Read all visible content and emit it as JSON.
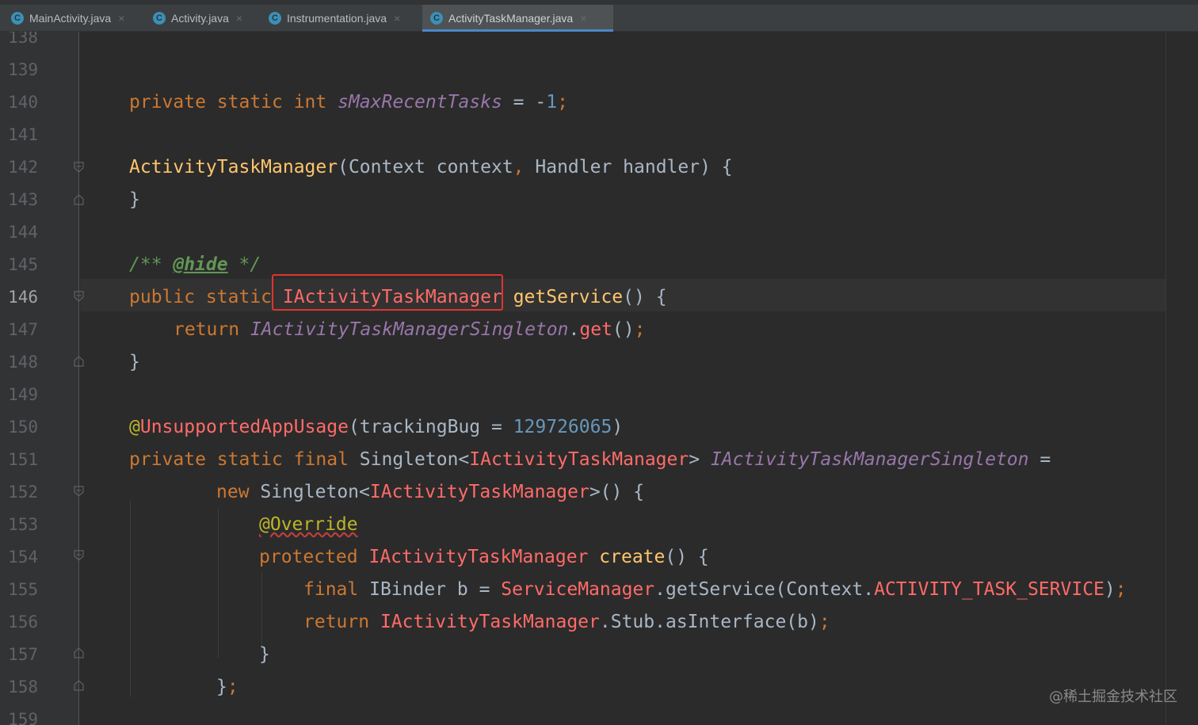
{
  "tabs": [
    {
      "label": "MainActivity.java",
      "icon": "class-icon"
    },
    {
      "label": "Activity.java",
      "icon": "class-icon"
    },
    {
      "label": "Instrumentation.java",
      "icon": "class-icon"
    },
    {
      "label": "ActivityTaskManager.java",
      "icon": "class-icon",
      "active": true
    }
  ],
  "tab_icon_letter": "C",
  "tab_close_glyph": "×",
  "line_numbers": [
    "138",
    "139",
    "140",
    "141",
    "142",
    "143",
    "144",
    "145",
    "146",
    "147",
    "148",
    "149",
    "150",
    "151",
    "152",
    "153",
    "154",
    "155",
    "156",
    "157",
    "158",
    "159"
  ],
  "current_line": "146",
  "code": {
    "l140": {
      "a": "private static int ",
      "b": "sMaxRecentTasks",
      "c": " = -",
      "d": "1",
      "e": ";"
    },
    "l142": {
      "a": "ActivityTaskManager",
      "b": "(Context context",
      "c": ",",
      "d": " Handler handler) {"
    },
    "l143": {
      "a": "}"
    },
    "l145": {
      "a": "/** ",
      "b": "@hide",
      "c": " */"
    },
    "l146": {
      "a": "public static ",
      "b": "IActivityTaskManager",
      "c": " ",
      "d": "getService",
      "e": "() {"
    },
    "l147": {
      "a": "return ",
      "b": "IActivityTaskManagerSingleton",
      "c": ".",
      "d": "get",
      "e": "()",
      "f": ";"
    },
    "l148": {
      "a": "}"
    },
    "l150": {
      "a": "@",
      "b": "UnsupportedAppUsage",
      "c": "(trackingBug = ",
      "d": "129726065",
      "e": ")"
    },
    "l151": {
      "a": "private static final ",
      "b": "Singleton<",
      "c": "IActivityTaskManager",
      "d": "> ",
      "e": "IActivityTaskManagerSingleton",
      "f": " ="
    },
    "l152": {
      "a": "new ",
      "b": "Singleton<",
      "c": "IActivityTaskManager",
      "d": ">() {"
    },
    "l153": {
      "a": "@Override"
    },
    "l154": {
      "a": "protected ",
      "b": "IActivityTaskManager",
      "c": " ",
      "d": "create",
      "e": "() {"
    },
    "l155": {
      "a": "final ",
      "b": "IBinder b = ",
      "c": "ServiceManager",
      "d": ".getService(Context.",
      "e": "ACTIVITY_TASK_SERVICE",
      "f": ")",
      "g": ";"
    },
    "l156": {
      "a": "return ",
      "b": "IActivityTaskManager",
      "c": ".Stub.asInterface(b)",
      "d": ";"
    },
    "l157": {
      "a": "}"
    },
    "l158": {
      "a": "}",
      "b": ";"
    }
  },
  "watermark": "@稀土掘金技术社区",
  "colors": {
    "background": "#2b2b2b",
    "keyword": "#cc7832",
    "static_field": "#9876aa",
    "number": "#6897bb",
    "method_decl": "#ffc66d",
    "unresolved": "#ff6b68",
    "comment": "#629755",
    "annotation": "#bbb529",
    "highlight_box": "#e0342e"
  }
}
